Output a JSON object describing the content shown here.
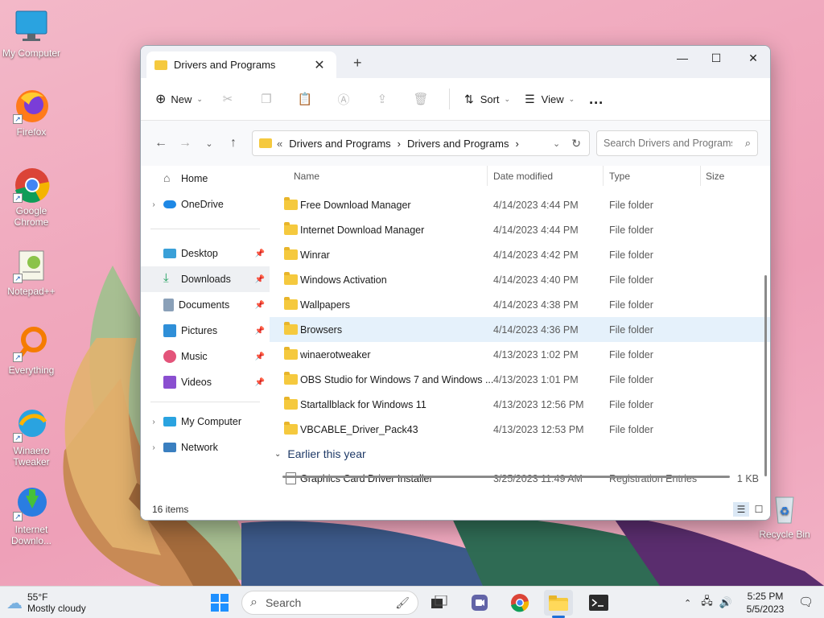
{
  "desktop": {
    "icons": [
      {
        "label": "My Computer"
      },
      {
        "label": "Firefox"
      },
      {
        "label": "Google Chrome"
      },
      {
        "label": "Notepad++"
      },
      {
        "label": "Everything"
      },
      {
        "label": "Winaero Tweaker"
      },
      {
        "label": "Internet Downlo..."
      },
      {
        "label": "Recycle Bin"
      }
    ]
  },
  "window": {
    "tab_title": "Drivers and Programs",
    "toolbar": {
      "new_label": "New",
      "sort_label": "Sort",
      "view_label": "View",
      "more": "..."
    },
    "address": {
      "prefix": "«",
      "crumbs": [
        "Drivers and Programs",
        "Drivers and Programs"
      ]
    },
    "search": {
      "placeholder": "Search Drivers and Programs"
    },
    "sidebar": {
      "items": [
        {
          "label": "Home"
        },
        {
          "label": "OneDrive"
        },
        {
          "label": "Desktop"
        },
        {
          "label": "Downloads"
        },
        {
          "label": "Documents"
        },
        {
          "label": "Pictures"
        },
        {
          "label": "Music"
        },
        {
          "label": "Videos"
        },
        {
          "label": "My Computer"
        },
        {
          "label": "Network"
        }
      ]
    },
    "columns": {
      "name": "Name",
      "date": "Date modified",
      "type": "Type",
      "size": "Size"
    },
    "rows": [
      {
        "name": "Free Download Manager",
        "date": "4/14/2023 4:44 PM",
        "type": "File folder",
        "size": ""
      },
      {
        "name": "Internet Download Manager",
        "date": "4/14/2023 4:44 PM",
        "type": "File folder",
        "size": ""
      },
      {
        "name": "Winrar",
        "date": "4/14/2023 4:42 PM",
        "type": "File folder",
        "size": ""
      },
      {
        "name": "Windows Activation",
        "date": "4/14/2023 4:40 PM",
        "type": "File folder",
        "size": ""
      },
      {
        "name": "Wallpapers",
        "date": "4/14/2023 4:38 PM",
        "type": "File folder",
        "size": ""
      },
      {
        "name": "Browsers",
        "date": "4/14/2023 4:36 PM",
        "type": "File folder",
        "size": ""
      },
      {
        "name": "winaerotweaker",
        "date": "4/13/2023 1:02 PM",
        "type": "File folder",
        "size": ""
      },
      {
        "name": "OBS Studio for Windows 7 and Windows ...",
        "date": "4/13/2023 1:01 PM",
        "type": "File folder",
        "size": ""
      },
      {
        "name": "Startallblack for Windows 11",
        "date": "4/13/2023 12:56 PM",
        "type": "File folder",
        "size": ""
      },
      {
        "name": "VBCABLE_Driver_Pack43",
        "date": "4/13/2023 12:53 PM",
        "type": "File folder",
        "size": ""
      }
    ],
    "group_label": "Earlier this year",
    "group_rows": [
      {
        "name": "Graphics Card Driver Installer",
        "date": "3/25/2023 11:49 AM",
        "type": "Registration Entries",
        "size": "1 KB"
      }
    ],
    "status": "16 items"
  },
  "taskbar": {
    "weather_temp": "55°F",
    "weather_desc": "Mostly cloudy",
    "search_label": "Search",
    "time": "5:25 PM",
    "date": "5/5/2023"
  }
}
